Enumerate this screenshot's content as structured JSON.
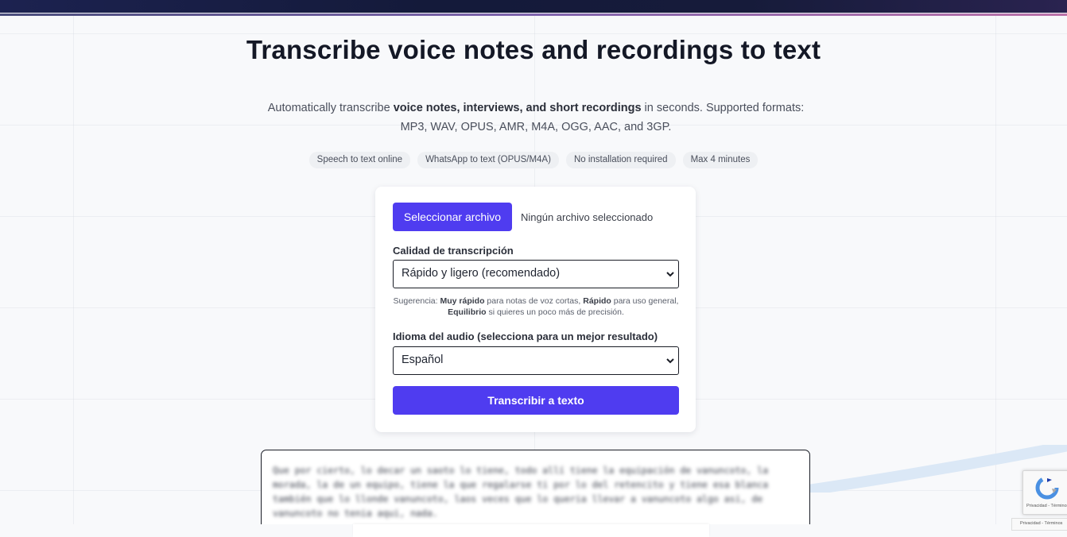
{
  "hero": {
    "title": "Transcribe voice notes and recordings to text",
    "intro_pre": "Automatically transcribe ",
    "intro_bold": "voice notes, interviews, and short recordings",
    "intro_post": " in seconds. Supported formats: MP3, WAV, OPUS, AMR, M4A, OGG, AAC, and 3GP."
  },
  "tags": [
    "Speech to text online",
    "WhatsApp to text (OPUS/M4A)",
    "No installation required",
    "Max 4 minutes"
  ],
  "form": {
    "file_button": "Seleccionar archivo",
    "file_status": "Ningún archivo seleccionado",
    "quality_label": "Calidad de transcripción",
    "quality_value": "Rápido y ligero (recomendado)",
    "hint": {
      "prefix": "Sugerencia: ",
      "b1": "Muy rápido",
      "t1": " para notas de voz cortas, ",
      "b2": "Rápido",
      "t2": " para uso general, ",
      "b3": "Equilibrio",
      "t3": " si quieres un poco más de precisión."
    },
    "language_label": "Idioma del audio (selecciona para un mejor resultado)",
    "language_value": "Español",
    "submit_label": "Transcribir a texto"
  },
  "result": {
    "text": "Que por cierto, lo decar un saoto lo tiene, todo allí tiene la equipación de vanuncoto, la morada, la de un equipo, tiene la que regalarse ti por lo del retencito y tiene esa blanca también que lo llonde vanuncoto, laos veces que lo queria llevar a vanuncoto algo asi, de vanuncoto no tenia aqui, nada."
  },
  "recaptcha": {
    "text": "Privacidad - Términos"
  },
  "colors": {
    "accent": "#4f3cf0",
    "topbar": "#141a3a"
  }
}
